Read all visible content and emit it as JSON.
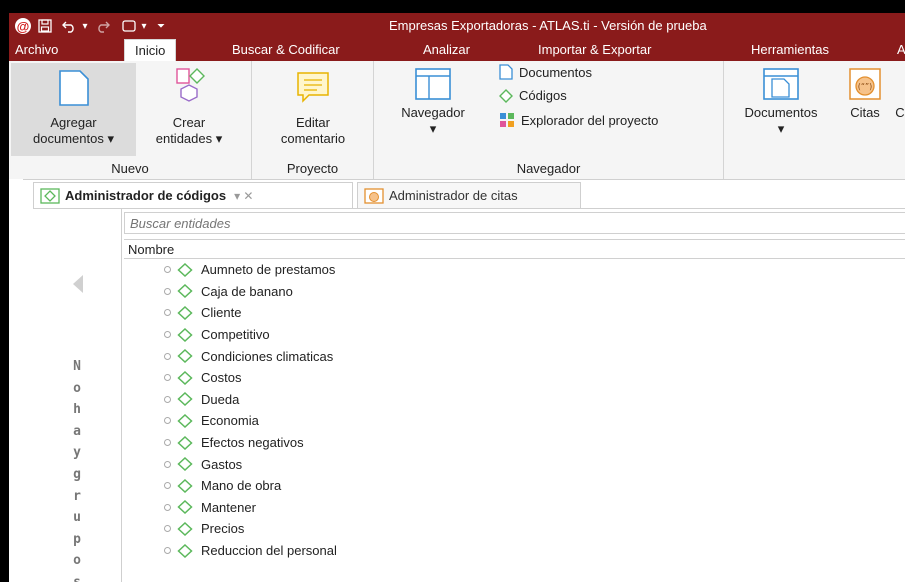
{
  "window": {
    "title": "Empresas Exportadoras - ATLAS.ti - Versión de prueba"
  },
  "menu_tabs": [
    "Archivo",
    "Inicio",
    "Buscar & Codificar",
    "Analizar",
    "Importar & Exportar",
    "Herramientas",
    "A"
  ],
  "ribbon": {
    "nuevo": {
      "label": "Nuevo",
      "add_docs": {
        "line1": "Agregar",
        "line2": "documentos ▾"
      },
      "create": {
        "line1": "Crear",
        "line2": "entidades ▾"
      }
    },
    "proyecto": {
      "label": "Proyecto",
      "edit_comment": {
        "line1": "Editar",
        "line2": "comentario"
      }
    },
    "navegador": {
      "label": "Navegador",
      "big": {
        "line1": "Navegador",
        "line2": "▾"
      },
      "items": [
        "Documentos",
        "Códigos",
        "Explorador del proyecto"
      ]
    },
    "right": {
      "documentos": {
        "line1": "Documentos",
        "line2": "▾"
      },
      "citas": "Citas",
      "partial": "C"
    }
  },
  "tabs": [
    {
      "label": "Administrador de códigos",
      "controls": "▾  ✕"
    },
    {
      "label": "Administrador de citas"
    }
  ],
  "code_manager": {
    "search_placeholder": "Buscar entidades",
    "column_header": "Nombre",
    "no_groups_text": [
      "N",
      "o",
      "h",
      "a",
      "y",
      "g",
      "r",
      "u",
      "p",
      "o",
      "s"
    ],
    "codes": [
      "Aumneto de prestamos",
      "Caja de banano",
      "Cliente",
      "Competitivo",
      "Condiciones climaticas",
      "Costos",
      "Dueda",
      "Economia",
      "Efectos negativos",
      "Gastos",
      "Mano de obra",
      "Mantener",
      "Precios",
      "Reduccion del personal"
    ]
  },
  "colors": {
    "titlebar": "#8a1b1b",
    "code_icon": "#5cb85c",
    "accent": "#3a8fd6"
  }
}
